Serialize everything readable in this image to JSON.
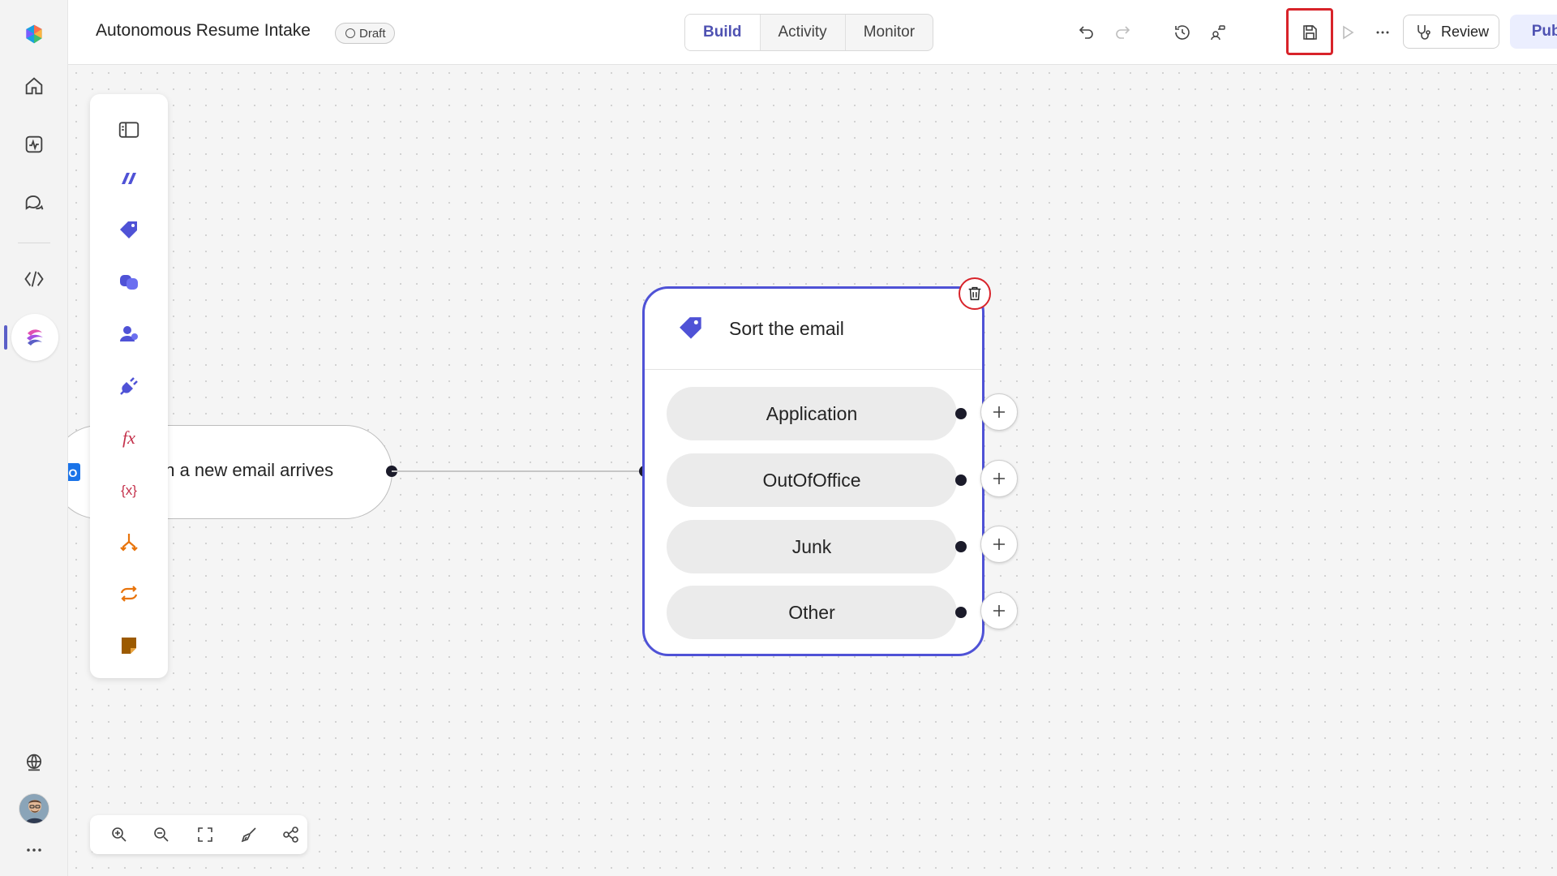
{
  "header": {
    "title": "Autonomous Resume Intake",
    "status": "Draft",
    "tabs": [
      {
        "label": "Build",
        "active": true
      },
      {
        "label": "Activity",
        "active": false
      },
      {
        "label": "Monitor",
        "active": false
      }
    ],
    "review_label": "Review",
    "publish_label": "Publish"
  },
  "rail": {
    "items": [
      "home-icon",
      "activity-icon",
      "chat-icon",
      "code-icon",
      "flows-icon"
    ],
    "active": "flows-icon"
  },
  "canvas": {
    "trigger": {
      "label": "en a new email arrives"
    },
    "node": {
      "title": "Sort the email",
      "branches": [
        "Application",
        "OutOfOffice",
        "Junk",
        "Other"
      ]
    }
  },
  "colors": {
    "accent": "#4f52d6",
    "brand": "#5b5fc7",
    "highlight": "#d8232a",
    "publish_bg": "#ebeefe"
  }
}
